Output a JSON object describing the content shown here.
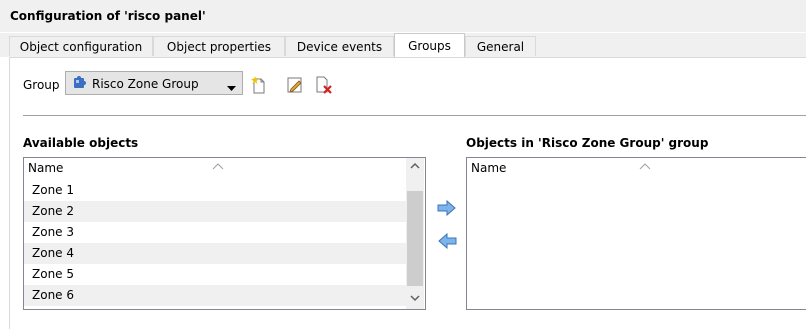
{
  "window": {
    "title": "Configuration of 'risco panel'"
  },
  "tabs": [
    {
      "label": "Object configuration",
      "active": false
    },
    {
      "label": "Object properties",
      "active": false
    },
    {
      "label": "Device events",
      "active": false
    },
    {
      "label": "Groups",
      "active": true
    },
    {
      "label": "General",
      "active": false
    }
  ],
  "group_row": {
    "label": "Group",
    "selected_group": "Risco Zone Group",
    "icons": [
      "puzzle-icon",
      "new-group-icon",
      "edit-group-icon",
      "delete-group-icon"
    ]
  },
  "available": {
    "title": "Available objects",
    "column_header": "Name",
    "items": [
      "Zone 1",
      "Zone 2",
      "Zone 3",
      "Zone 4",
      "Zone 5",
      "Zone 6"
    ]
  },
  "in_group": {
    "title": "Objects in 'Risco Zone Group' group",
    "column_header": "Name",
    "items": []
  },
  "colors": {
    "tab_background": "#f0f0f0",
    "alt_row": "#f0f0f0",
    "arrow_blue": "#4f8fd9"
  }
}
